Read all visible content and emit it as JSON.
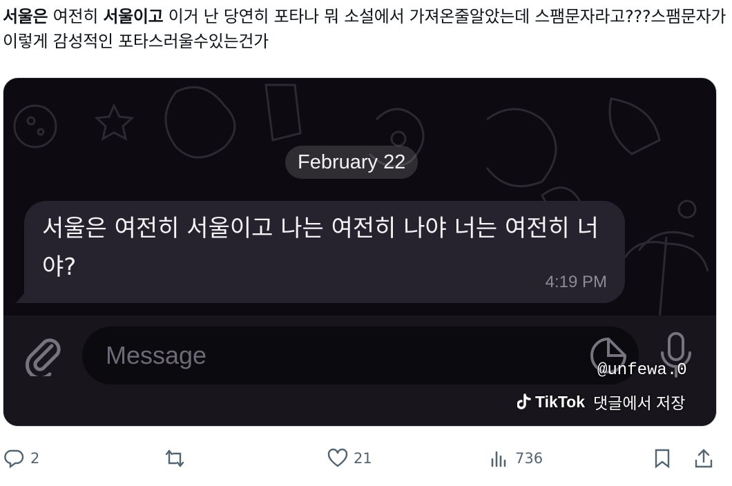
{
  "tweet": {
    "bold_1": "서울은",
    "text_1": " 여전히 ",
    "bold_2": "서울이고",
    "text_2": " 이거 난 당연히 포타나 뭐 소설에서 가져온줄알았는데 스팸문자라고???스팸문자가 이렇게 감성적인 포타스러울수있는건가"
  },
  "media": {
    "date_label": "February 22",
    "message_text": "서울은 여전히 서울이고 나는 여전히 나야 너는 여전히 너야?",
    "message_time": "4:19 PM",
    "input_placeholder": "Message",
    "watermark_user": "@unfewa.0",
    "watermark_brand": "TikTok",
    "watermark_caption": "댓글에서 저장"
  },
  "actions": {
    "replies": "2",
    "retweets": "",
    "likes": "21",
    "views": "736"
  },
  "icons": {
    "reply": "reply-icon",
    "retweet": "retweet-icon",
    "like": "heart-icon",
    "views": "views-chart-icon",
    "bookmark": "bookmark-icon",
    "share": "share-icon",
    "attach": "paperclip-icon",
    "sticker": "sticker-icon",
    "mic": "microphone-icon",
    "tiktok": "tiktok-logo-icon"
  },
  "colors": {
    "text": "#0f1419",
    "muted": "#536471",
    "chat_bg": "#0d0b11",
    "bubble": "#26232e"
  }
}
